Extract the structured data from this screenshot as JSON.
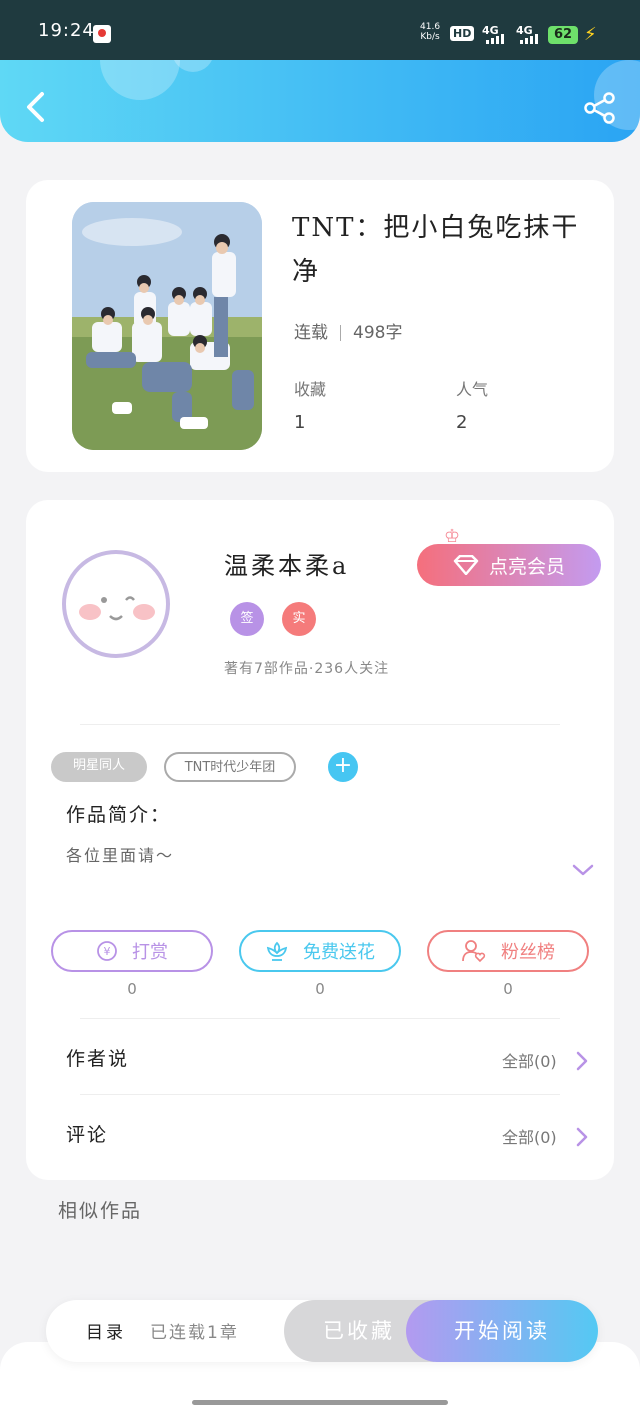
{
  "status_bar": {
    "time": "19:24",
    "net_speed_value": "41.6",
    "net_speed_unit": "Kb/s",
    "hd_label": "HD",
    "signal_1": "4G",
    "signal_2": "4G",
    "battery": "62",
    "colors": {
      "bg": "#1f3a3f",
      "battery": "#6ee06b",
      "charging": "#ffd21f"
    }
  },
  "header": {
    "back_icon": "chevron-left-icon",
    "share_icon": "share-icon",
    "gradient": [
      "#5fd8f5",
      "#2aa4f3"
    ]
  },
  "book": {
    "title": "TNT：把小白兔吃抹干净",
    "status": "连载",
    "word_count": "498字",
    "favorites_label": "收藏",
    "favorites_value": "1",
    "popularity_label": "人气",
    "popularity_value": "2"
  },
  "author": {
    "name": "温柔本柔a",
    "vip_button": "点亮会员",
    "badge_1": "签",
    "badge_2": "实",
    "stats": "著有7部作品·236人关注",
    "colors": {
      "badge_1": "#b892e6",
      "badge_2": "#f57b7b"
    }
  },
  "tags": [
    "明星同人",
    "TNT时代少年团"
  ],
  "intro": {
    "title": "作品简介：",
    "text": "各位里面请～"
  },
  "actions": [
    {
      "label": "打赏",
      "count": "0",
      "icon": "yen-icon",
      "color": "#b892e6"
    },
    {
      "label": "免费送花",
      "count": "0",
      "icon": "flower-icon",
      "color": "#4ac8ee"
    },
    {
      "label": "粉丝榜",
      "count": "0",
      "icon": "fan-user-icon",
      "color": "#f08080"
    }
  ],
  "rows": {
    "author_says": "作者说",
    "author_says_all": "全部(0)",
    "comments": "评论",
    "comments_all": "全部(0)"
  },
  "similar_title": "相似作品",
  "bottom_bar": {
    "toc": "目录",
    "toc_status": "已连载1章",
    "collected": "已收藏",
    "start_reading": "开始阅读"
  }
}
